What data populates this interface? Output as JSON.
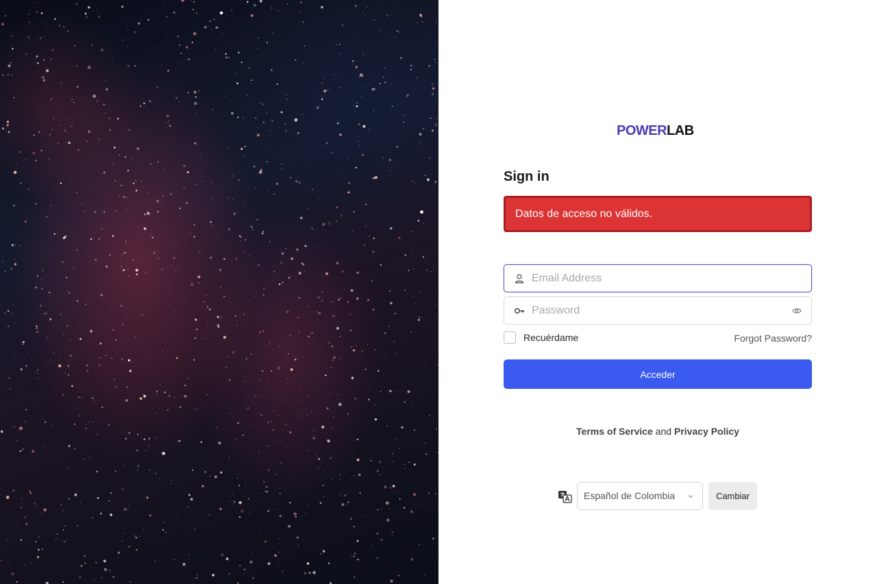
{
  "brand": {
    "logo_part1": "POWER",
    "logo_part2": "LAB"
  },
  "login": {
    "title": "Sign in",
    "error_message": "Datos de acceso no válidos.",
    "email_placeholder": "Email Address",
    "password_placeholder": "Password",
    "remember_label": "Recuérdame",
    "forgot_link": "Forgot Password?",
    "submit_label": "Acceder"
  },
  "legal": {
    "terms_link": "Terms of Service",
    "connector": "and",
    "privacy_link": "Privacy Policy"
  },
  "language": {
    "selected": "Español de Colombia",
    "change_button": "Cambiar"
  },
  "icons": {
    "email": "user-icon",
    "password": "key-icon",
    "reveal": "eye-icon",
    "language": "translate-icon",
    "dropdown": "chevron-down-icon"
  },
  "colors": {
    "primary": "#3a5af0",
    "error": "#dc3434",
    "brand_accent": "#4a3bb5",
    "focus_border": "#5b54c6"
  }
}
